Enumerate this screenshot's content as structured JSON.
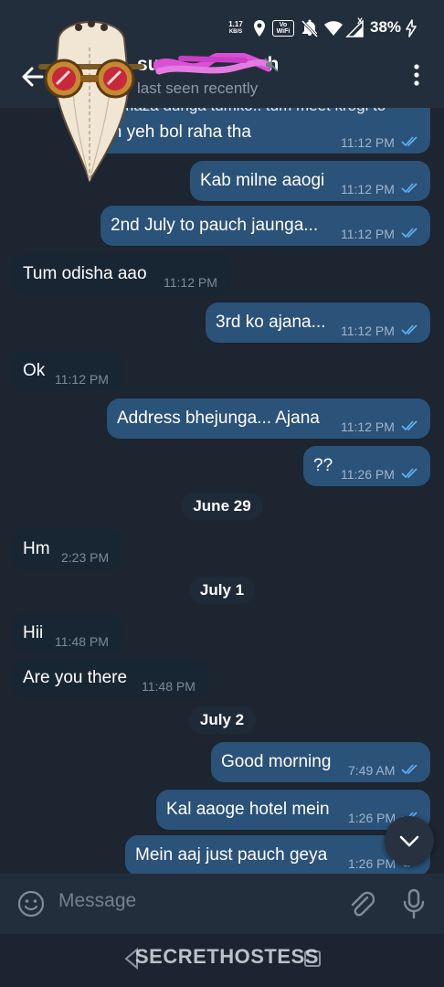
{
  "status_bar": {
    "speed_value": "1.17",
    "speed_unit": "KB/S",
    "wifi_label": "Vo WiFi",
    "network_label": "X",
    "battery": "38%"
  },
  "header": {
    "name_prefix": "su",
    "name_suffix": "h",
    "last_seen": "last seen recently",
    "icons": [
      "back-arrow-icon",
      "more-vert-icon",
      "mute-icon"
    ]
  },
  "messages": [
    {
      "dir": "out",
      "text": "a maza dunga tumko.. tum meet krogi to",
      "time": "",
      "ticks": false
    },
    {
      "dir": "out",
      "text": "ein yeh bol raha tha",
      "time": "11:12 PM",
      "ticks": true
    },
    {
      "dir": "out",
      "text": "Kab milne aaogi",
      "time": "11:12 PM",
      "ticks": true
    },
    {
      "dir": "out",
      "text": "2nd July to pauch jaunga...",
      "time": "11:12 PM",
      "ticks": true
    },
    {
      "dir": "in",
      "text": "Tum odisha aao",
      "time": "11:12 PM"
    },
    {
      "dir": "out",
      "text": "3rd ko ajana...",
      "time": "11:12 PM",
      "ticks": true
    },
    {
      "dir": "in",
      "text": "Ok",
      "time": "11:12 PM"
    },
    {
      "dir": "out",
      "text": "Address bhejunga... Ajana",
      "time": "11:12 PM",
      "ticks": true
    },
    {
      "dir": "out",
      "text": "??",
      "time": "11:26 PM",
      "ticks": true
    },
    {
      "dir": "in",
      "text": "Hm",
      "time": "2:23 PM"
    },
    {
      "dir": "in",
      "text": "Hii",
      "time": "11:48 PM"
    },
    {
      "dir": "in",
      "text": "Are you there",
      "time": "11:48 PM"
    },
    {
      "dir": "out",
      "text": "Good morning",
      "time": "7:49 AM",
      "ticks": true
    },
    {
      "dir": "out",
      "text": "Kal aaoge hotel mein",
      "time": "1:26 PM",
      "ticks": true
    },
    {
      "dir": "out",
      "text": "Mein aaj just pauch geya",
      "time": "1:26 PM",
      "ticks": true
    }
  ],
  "date_separators": [
    "June 29",
    "July 1",
    "July 2"
  ],
  "input": {
    "placeholder": "Message"
  },
  "watermark": "SECRETHOSTESS",
  "colors": {
    "background": "#1c2530",
    "header": "#232e3c",
    "outgoing_bubble": "#2b5278",
    "incoming_bubble": "#182533",
    "tick_blue": "#5fb4f5"
  }
}
